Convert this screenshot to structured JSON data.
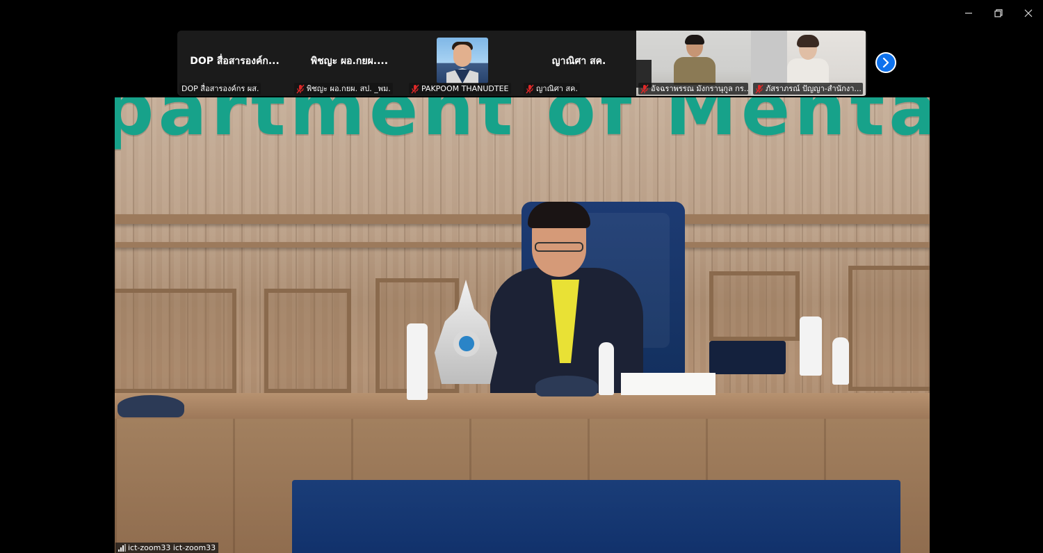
{
  "window": {
    "controls": {
      "minimize_icon": "minimize-icon",
      "restore_icon": "restore-icon",
      "close_icon": "close-icon"
    }
  },
  "participants_strip": {
    "tiles": [
      {
        "display_name": "DOP สื่อสารองค์ก...",
        "label": "DOP สื่อสารองค์กร ผส.",
        "muted": false,
        "type": "name"
      },
      {
        "display_name": "พิชญะ  ผอ.กยผ....",
        "label": "พิชญะ  ผอ.กยผ. สป. _พม.",
        "muted": true,
        "type": "name"
      },
      {
        "display_name": "",
        "label": "PAKPOOM THANUDTEE",
        "muted": true,
        "type": "avatar"
      },
      {
        "display_name": "ญาณิศา สค.",
        "label": "ญาณิศา สค.",
        "muted": true,
        "type": "name"
      },
      {
        "display_name": "",
        "label": "อัจฉราพรรณ มังกรานุกูล กร...",
        "muted": true,
        "type": "video"
      },
      {
        "display_name": "",
        "label": "ภัสราภรณ์ ปัญญา-สำนักงา...",
        "muted": true,
        "type": "video"
      }
    ],
    "next_icon": "chevron-right-icon"
  },
  "main_video": {
    "wall_sign_text": "partment of Mental He",
    "speaker_label": "ict-zoom33 ict-zoom33",
    "signal_icon": "signal-bars-icon"
  },
  "colors": {
    "background": "#000000",
    "strip_bg": "#1a1a1a",
    "accent_blue": "#0e72ed",
    "mute_red": "#e02828",
    "sign_green": "#17a28a"
  }
}
